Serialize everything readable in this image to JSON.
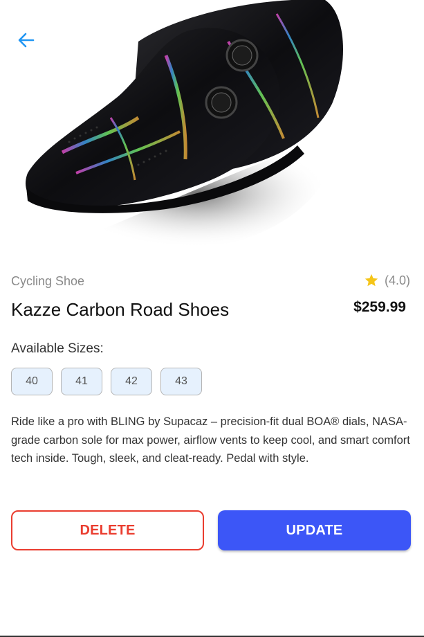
{
  "header": {
    "back_icon": "arrow-left-icon",
    "accent": "#2196f3"
  },
  "product": {
    "image_alt": "Black iridescent cycling shoe with dual BOA dials",
    "category": "Cycling Shoe",
    "rating_text": "(4.0)",
    "rating_value": 4.0,
    "rating_icon": "star-icon",
    "name": "Kazze Carbon Road Shoes",
    "price": "$259.99",
    "sizes_label": "Available Sizes:",
    "sizes": [
      "40",
      "41",
      "42",
      "43"
    ],
    "description": "Ride like a pro with BLING by Supacaz – precision-fit dual BOA® dials, NASA-grade carbon sole for max power, airflow vents to keep cool, and smart comfort tech inside. Tough, sleek, and cleat-ready. Pedal with style."
  },
  "actions": {
    "delete_label": "DELETE",
    "update_label": "UPDATE",
    "delete_color": "#ea3d2f",
    "update_color": "#3c56f7"
  },
  "colors": {
    "star": "#f5c518",
    "chip_bg": "#e6f1fd"
  }
}
